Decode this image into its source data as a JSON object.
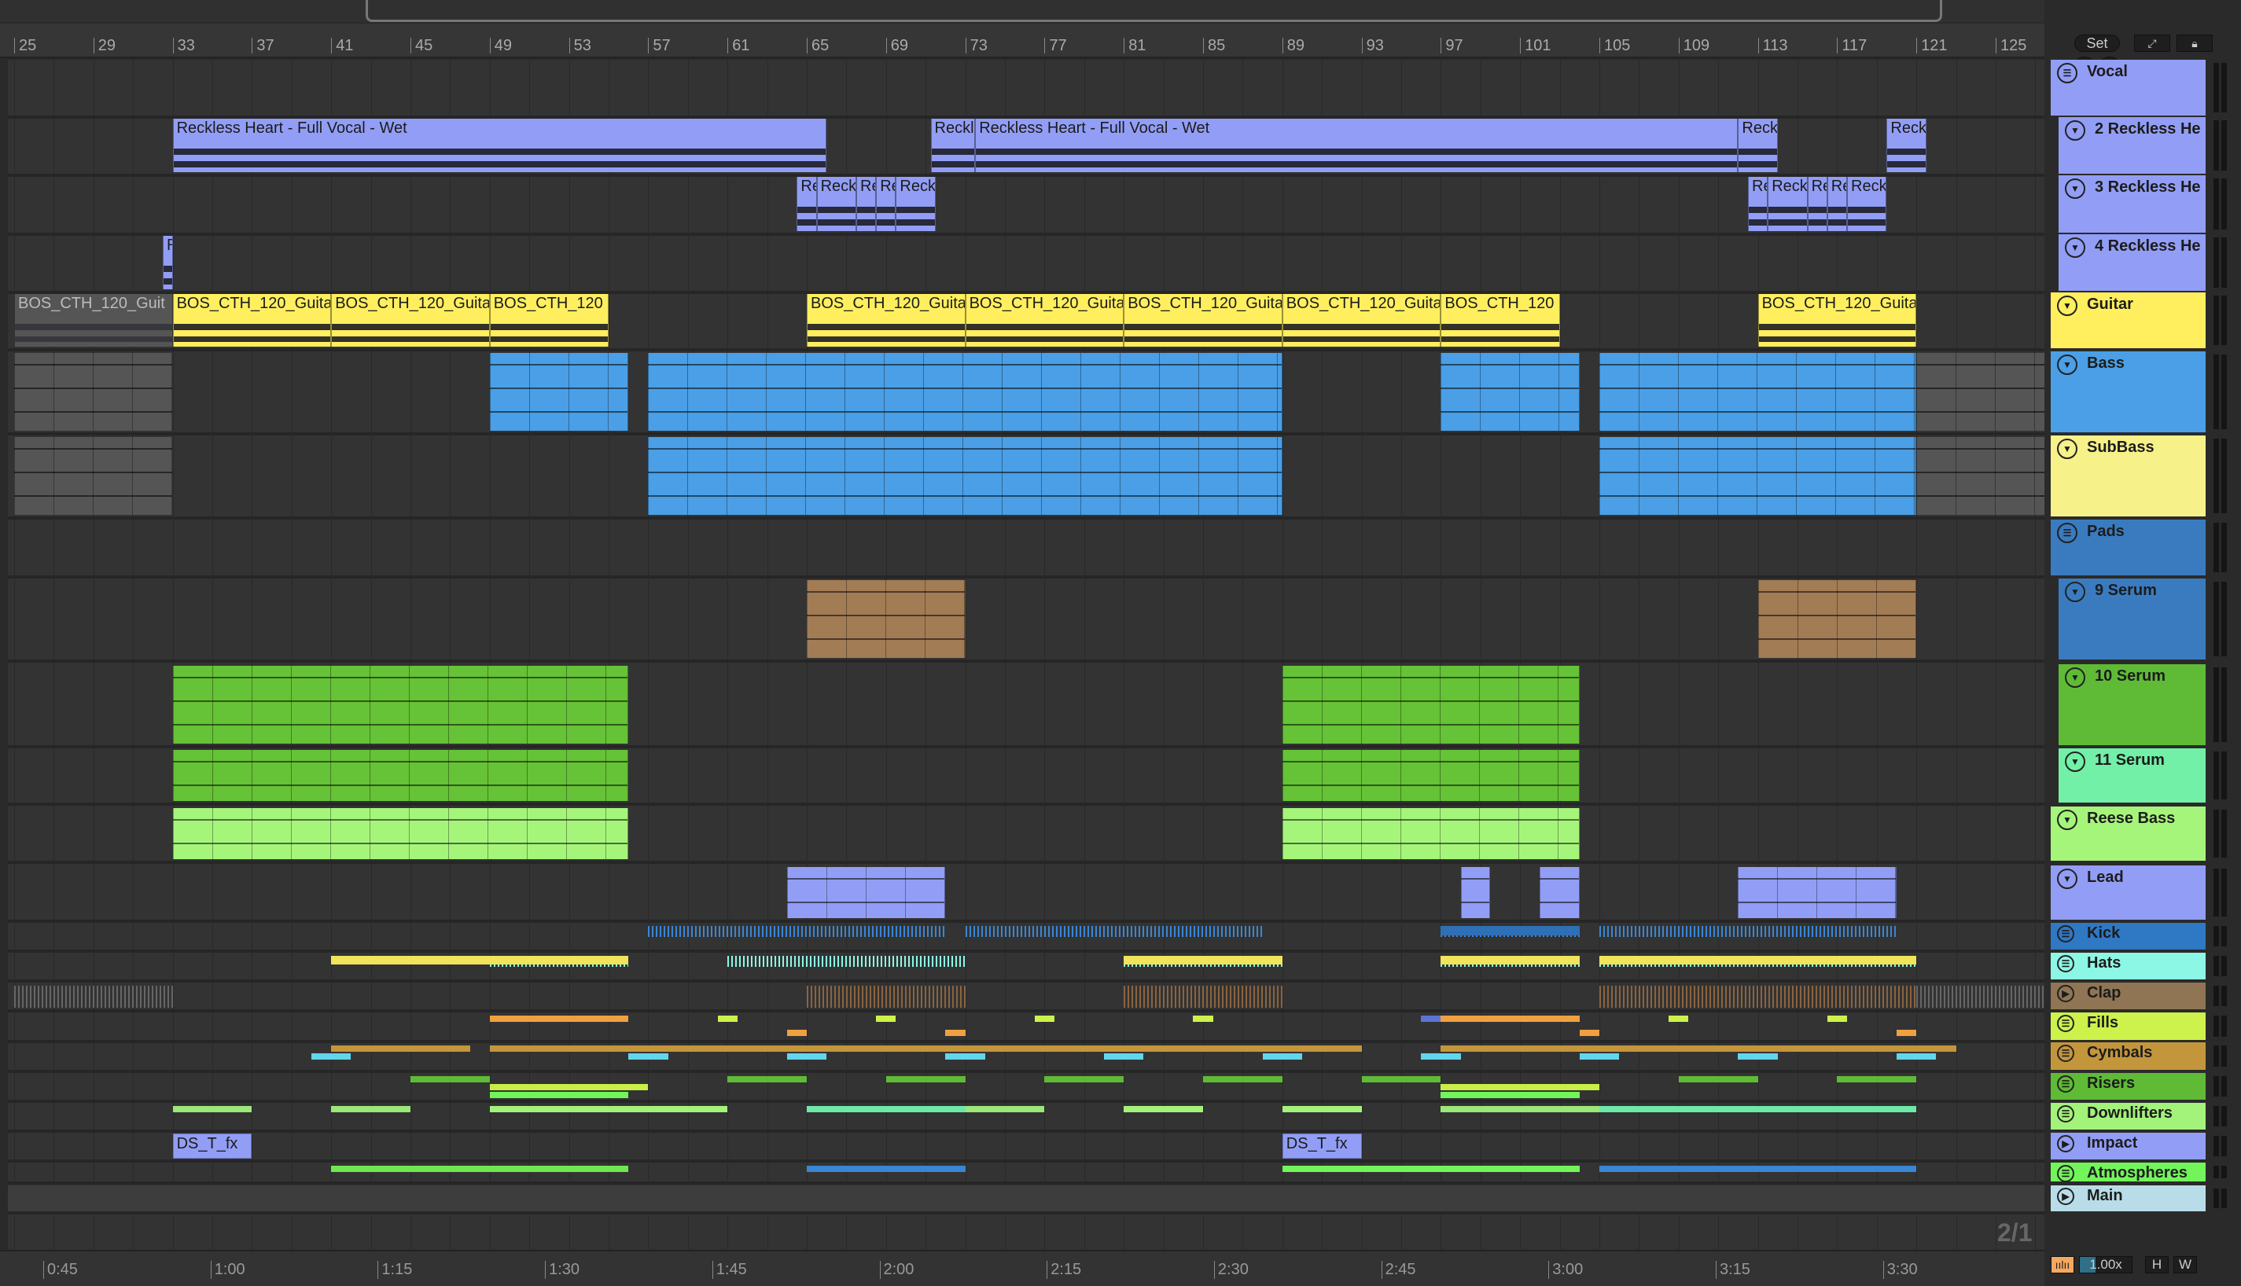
{
  "ruler": {
    "bars": [
      "25",
      "29",
      "33",
      "37",
      "41",
      "45",
      "49",
      "53",
      "57",
      "61",
      "65",
      "69",
      "73",
      "77",
      "81",
      "85",
      "89",
      "93",
      "97",
      "101",
      "105",
      "109",
      "113",
      "117",
      "121",
      "125"
    ]
  },
  "time_ruler": [
    "0:45",
    "1:00",
    "1:15",
    "1:30",
    "1:45",
    "2:00",
    "2:15",
    "2:30",
    "2:45",
    "3:00",
    "3:15",
    "3:30"
  ],
  "controls": {
    "set": "Set",
    "back_icon": "arrow-left-icon",
    "forward_icon": "arrow-right-icon",
    "zoom": "1.00x",
    "h": "H",
    "w": "W",
    "signature": "2/1"
  },
  "tracks": [
    {
      "name": "Vocal",
      "color": "#929ef5",
      "icon": "group",
      "clips": []
    },
    {
      "name": "2 Reckless He",
      "color": "#929ef5",
      "icon": "fold",
      "child": true,
      "clips": [
        {
          "s": 33,
          "e": 66,
          "label": "Reckless Heart - Full Vocal - Wet",
          "kind": "wave"
        },
        {
          "s": 71.25,
          "e": 73.5,
          "label": "Reckl",
          "kind": "wave"
        },
        {
          "s": 73.5,
          "e": 112,
          "label": "Reckless Heart - Full Vocal - Wet",
          "kind": "wave"
        },
        {
          "s": 112,
          "e": 114,
          "label": "Reck",
          "kind": "wave"
        },
        {
          "s": 119.5,
          "e": 121.5,
          "label": "Reckl",
          "kind": "wave"
        }
      ]
    },
    {
      "name": "3 Reckless He",
      "color": "#929ef5",
      "icon": "fold",
      "child": true,
      "clips": [
        {
          "s": 64.5,
          "e": 65.5,
          "label": "Re",
          "kind": "wave"
        },
        {
          "s": 65.5,
          "e": 67.5,
          "label": "Reck",
          "kind": "wave"
        },
        {
          "s": 67.5,
          "e": 68.5,
          "label": "Re",
          "kind": "wave"
        },
        {
          "s": 68.5,
          "e": 69.5,
          "label": "Re",
          "kind": "wave"
        },
        {
          "s": 69.5,
          "e": 71.5,
          "label": "Reck",
          "kind": "wave"
        },
        {
          "s": 112.5,
          "e": 113.5,
          "label": "Re",
          "kind": "wave"
        },
        {
          "s": 113.5,
          "e": 115.5,
          "label": "Reck",
          "kind": "wave"
        },
        {
          "s": 115.5,
          "e": 116.5,
          "label": "Re",
          "kind": "wave"
        },
        {
          "s": 116.5,
          "e": 117.5,
          "label": "Re",
          "kind": "wave"
        },
        {
          "s": 117.5,
          "e": 119.5,
          "label": "Reck",
          "kind": "wave"
        }
      ]
    },
    {
      "name": "4 Reckless He",
      "color": "#929ef5",
      "icon": "fold",
      "child": true,
      "clips": [
        {
          "s": 32.5,
          "e": 33,
          "label": "R",
          "kind": "wave"
        }
      ]
    },
    {
      "name": "Guitar",
      "color": "#ffef5e",
      "icon": "fold",
      "clips": [
        {
          "s": 25,
          "e": 33,
          "label": "BOS_CTH_120_Guit",
          "kind": "wave",
          "off": true
        },
        {
          "s": 33,
          "e": 41,
          "label": "BOS_CTH_120_Guita",
          "kind": "wave"
        },
        {
          "s": 41,
          "e": 49,
          "label": "BOS_CTH_120_Guita",
          "kind": "wave"
        },
        {
          "s": 49,
          "e": 55,
          "label": "BOS_CTH_120",
          "kind": "wave"
        },
        {
          "s": 65,
          "e": 73,
          "label": "BOS_CTH_120_Guita",
          "kind": "wave"
        },
        {
          "s": 73,
          "e": 81,
          "label": "BOS_CTH_120_Guita",
          "kind": "wave"
        },
        {
          "s": 81,
          "e": 89,
          "label": "BOS_CTH_120_Guita",
          "kind": "wave"
        },
        {
          "s": 89,
          "e": 97,
          "label": "BOS_CTH_120_Guita",
          "kind": "wave"
        },
        {
          "s": 97,
          "e": 103,
          "label": "BOS_CTH_120",
          "kind": "wave"
        },
        {
          "s": 113,
          "e": 121,
          "label": "BOS_CTH_120_Guita",
          "kind": "wave"
        }
      ]
    },
    {
      "name": "Bass",
      "color": "#4a9fe6",
      "icon": "fold",
      "clips": [
        {
          "s": 25,
          "e": 33,
          "label": "",
          "kind": "midi",
          "off": true
        },
        {
          "s": 49,
          "e": 56,
          "label": "",
          "kind": "midi"
        },
        {
          "s": 57,
          "e": 89,
          "label": "",
          "kind": "midi"
        },
        {
          "s": 97,
          "e": 104,
          "label": "",
          "kind": "midi"
        },
        {
          "s": 105,
          "e": 121,
          "label": "",
          "kind": "midi"
        },
        {
          "s": 121,
          "e": 127.5,
          "label": "",
          "kind": "midi",
          "off": true
        }
      ]
    },
    {
      "name": "SubBass",
      "color": "#f7f18a",
      "clipcolor": "#4a9fe6",
      "icon": "fold",
      "clips": [
        {
          "s": 25,
          "e": 33,
          "label": "",
          "kind": "midi",
          "off": true
        },
        {
          "s": 57,
          "e": 89,
          "label": "",
          "kind": "midi"
        },
        {
          "s": 105,
          "e": 121,
          "label": "",
          "kind": "midi"
        },
        {
          "s": 121,
          "e": 127.5,
          "label": "",
          "kind": "midi",
          "off": true
        }
      ]
    },
    {
      "name": "Pads",
      "color": "#3a7bc0",
      "icon": "group",
      "clips": []
    },
    {
      "name": "9 Serum",
      "color": "#3a7bc0",
      "clipcolor": "#a27c55",
      "icon": "fold",
      "child": true,
      "clips": [
        {
          "s": 65,
          "e": 73,
          "label": "",
          "kind": "midi"
        },
        {
          "s": 113,
          "e": 121,
          "label": "",
          "kind": "midi"
        }
      ]
    },
    {
      "name": "10 Serum",
      "color": "#5fbb36",
      "clipcolor": "#66c236",
      "icon": "fold",
      "child": true,
      "clips": [
        {
          "s": 33,
          "e": 56,
          "label": "",
          "kind": "midi"
        },
        {
          "s": 89,
          "e": 104,
          "label": "",
          "kind": "midi"
        }
      ]
    },
    {
      "name": "11 Serum",
      "color": "#72f0a8",
      "clipcolor": "#66c236",
      "icon": "fold",
      "child": true,
      "clips": [
        {
          "s": 33,
          "e": 56,
          "label": "",
          "kind": "midi"
        },
        {
          "s": 89,
          "e": 104,
          "label": "",
          "kind": "midi"
        }
      ]
    },
    {
      "name": "Reese Bass",
      "color": "#a6f57b",
      "icon": "fold",
      "clips": [
        {
          "s": 33,
          "e": 56,
          "label": "",
          "kind": "midi"
        },
        {
          "s": 89,
          "e": 104,
          "label": "",
          "kind": "midi"
        }
      ]
    },
    {
      "name": "Lead",
      "color": "#929ef5",
      "icon": "fold",
      "clips": [
        {
          "s": 64,
          "e": 72,
          "label": "",
          "kind": "midi"
        },
        {
          "s": 98,
          "e": 99.5,
          "label": "",
          "kind": "midi"
        },
        {
          "s": 102,
          "e": 104,
          "label": "",
          "kind": "midi"
        },
        {
          "s": 112,
          "e": 120,
          "label": "",
          "kind": "midi"
        }
      ]
    },
    {
      "name": "Kick",
      "color": "#2f78c4",
      "icon": "group",
      "clips": [
        {
          "s": 57,
          "e": 72,
          "kind": "ticks",
          "c": "#3a86d4"
        },
        {
          "s": 73,
          "e": 88,
          "kind": "ticks",
          "c": "#3a86d4"
        },
        {
          "s": 97,
          "e": 104,
          "kind": "ticks",
          "c": "#3a86d4"
        },
        {
          "s": 97,
          "e": 104,
          "kind": "bar",
          "c": "#2f6fb5",
          "lane": 1
        },
        {
          "s": 105,
          "e": 120,
          "kind": "ticks",
          "c": "#3a86d4"
        }
      ]
    },
    {
      "name": "Hats",
      "color": "#8cf7e5",
      "icon": "group",
      "clips": [
        {
          "s": 49,
          "e": 56,
          "kind": "ticks",
          "c": "#8cf7e5"
        },
        {
          "s": 61,
          "e": 73,
          "kind": "ticks",
          "c": "#8cf7e5"
        },
        {
          "s": 81,
          "e": 89,
          "kind": "ticks",
          "c": "#8cf7e5"
        },
        {
          "s": 97,
          "e": 104,
          "kind": "ticks",
          "c": "#8cf7e5"
        },
        {
          "s": 105,
          "e": 121,
          "kind": "ticks",
          "c": "#8cf7e5"
        },
        {
          "s": 41,
          "e": 56,
          "kind": "bar",
          "c": "#f0e45a",
          "lane": 1
        },
        {
          "s": 81,
          "e": 89,
          "kind": "bar",
          "c": "#f0e45a",
          "lane": 1
        },
        {
          "s": 97,
          "e": 104,
          "kind": "bar",
          "c": "#f0e45a",
          "lane": 1
        },
        {
          "s": 105,
          "e": 121,
          "kind": "bar",
          "c": "#f0e45a",
          "lane": 1
        }
      ]
    },
    {
      "name": "Clap",
      "color": "#8f7553",
      "icon": "play",
      "clips": [
        {
          "s": 25,
          "e": 33,
          "kind": "ticks",
          "c": "#666"
        },
        {
          "s": 65,
          "e": 73,
          "kind": "ticks",
          "c": "#8a6440"
        },
        {
          "s": 81,
          "e": 89,
          "kind": "ticks",
          "c": "#8a6440"
        },
        {
          "s": 105,
          "e": 121,
          "kind": "ticks",
          "c": "#8a6440"
        },
        {
          "s": 121,
          "e": 127.5,
          "kind": "ticks",
          "c": "#666"
        }
      ]
    },
    {
      "name": "Fills",
      "color": "#cdf24c",
      "icon": "group",
      "clips": [
        {
          "s": 60.5,
          "e": 61.5,
          "kind": "bar",
          "c": "#cdf24c",
          "lane": 0
        },
        {
          "s": 68.5,
          "e": 69.5,
          "kind": "bar",
          "c": "#cdf24c",
          "lane": 0
        },
        {
          "s": 76.5,
          "e": 77.5,
          "kind": "bar",
          "c": "#cdf24c",
          "lane": 0
        },
        {
          "s": 84.5,
          "e": 85.5,
          "kind": "bar",
          "c": "#cdf24c",
          "lane": 0
        },
        {
          "s": 108.5,
          "e": 109.5,
          "kind": "bar",
          "c": "#cdf24c",
          "lane": 0
        },
        {
          "s": 116.5,
          "e": 117.5,
          "kind": "bar",
          "c": "#cdf24c",
          "lane": 0
        },
        {
          "s": 64,
          "e": 65,
          "kind": "bar",
          "c": "#f0a040",
          "lane": 1
        },
        {
          "s": 72,
          "e": 73,
          "kind": "bar",
          "c": "#f0a040",
          "lane": 1
        },
        {
          "s": 104,
          "e": 105,
          "kind": "bar",
          "c": "#f0a040",
          "lane": 1
        },
        {
          "s": 120,
          "e": 121,
          "kind": "bar",
          "c": "#f0a040",
          "lane": 1
        },
        {
          "s": 96,
          "e": 98,
          "kind": "bar",
          "c": "#5b74d4",
          "lane": 2
        },
        {
          "s": 49,
          "e": 56,
          "kind": "bar",
          "c": "#f0a040",
          "lane": 3
        },
        {
          "s": 97,
          "e": 104,
          "kind": "bar",
          "c": "#f0a040",
          "lane": 3
        }
      ]
    },
    {
      "name": "Cymbals",
      "color": "#c4963c",
      "icon": "group",
      "clips": [
        {
          "s": 41,
          "e": 48,
          "kind": "bar",
          "c": "#c4963c",
          "lane": 0
        },
        {
          "s": 49,
          "e": 93,
          "kind": "bar",
          "c": "#c4963c",
          "lane": 0
        },
        {
          "s": 97,
          "e": 123,
          "kind": "bar",
          "c": "#c4963c",
          "lane": 0
        },
        {
          "s": 40,
          "e": 42,
          "kind": "bar",
          "c": "#62d6ec",
          "lane": 1
        },
        {
          "s": 56,
          "e": 58,
          "kind": "bar",
          "c": "#62d6ec",
          "lane": 1
        },
        {
          "s": 64,
          "e": 66,
          "kind": "bar",
          "c": "#62d6ec",
          "lane": 1
        },
        {
          "s": 72,
          "e": 74,
          "kind": "bar",
          "c": "#62d6ec",
          "lane": 1
        },
        {
          "s": 80,
          "e": 82,
          "kind": "bar",
          "c": "#62d6ec",
          "lane": 1
        },
        {
          "s": 88,
          "e": 90,
          "kind": "bar",
          "c": "#62d6ec",
          "lane": 1
        },
        {
          "s": 96,
          "e": 98,
          "kind": "bar",
          "c": "#62d6ec",
          "lane": 1
        },
        {
          "s": 104,
          "e": 106,
          "kind": "bar",
          "c": "#62d6ec",
          "lane": 1
        },
        {
          "s": 112,
          "e": 114,
          "kind": "bar",
          "c": "#62d6ec",
          "lane": 1
        },
        {
          "s": 120,
          "e": 122,
          "kind": "bar",
          "c": "#62d6ec",
          "lane": 1
        }
      ]
    },
    {
      "name": "Risers",
      "color": "#5fbb36",
      "icon": "group",
      "clips": [
        {
          "s": 45,
          "e": 49,
          "kind": "bar",
          "c": "#5fbb36",
          "lane": 0
        },
        {
          "s": 61,
          "e": 65,
          "kind": "bar",
          "c": "#5fbb36",
          "lane": 0
        },
        {
          "s": 69,
          "e": 73,
          "kind": "bar",
          "c": "#5fbb36",
          "lane": 0
        },
        {
          "s": 77,
          "e": 81,
          "kind": "bar",
          "c": "#5fbb36",
          "lane": 0
        },
        {
          "s": 85,
          "e": 89,
          "kind": "bar",
          "c": "#5fbb36",
          "lane": 0
        },
        {
          "s": 93,
          "e": 97,
          "kind": "bar",
          "c": "#5fbb36",
          "lane": 0
        },
        {
          "s": 109,
          "e": 113,
          "kind": "bar",
          "c": "#5fbb36",
          "lane": 0
        },
        {
          "s": 117,
          "e": 121,
          "kind": "bar",
          "c": "#5fbb36",
          "lane": 0
        },
        {
          "s": 49,
          "e": 57,
          "kind": "bar",
          "c": "#c8ee48",
          "lane": 1
        },
        {
          "s": 97,
          "e": 105,
          "kind": "bar",
          "c": "#c8ee48",
          "lane": 1
        },
        {
          "s": 49,
          "e": 56,
          "kind": "bar",
          "c": "#72f55a",
          "lane": 2
        },
        {
          "s": 97,
          "e": 104,
          "kind": "bar",
          "c": "#72f55a",
          "lane": 2
        }
      ]
    },
    {
      "name": "Downlifters",
      "color": "#a3f27a",
      "icon": "group",
      "clips": [
        {
          "s": 33,
          "e": 37,
          "kind": "bar",
          "c": "#9be77a",
          "lane": 0
        },
        {
          "s": 41,
          "e": 45,
          "kind": "bar",
          "c": "#9be77a",
          "lane": 0
        },
        {
          "s": 49,
          "e": 61,
          "kind": "bar",
          "c": "#a3f27a",
          "lane": 0
        },
        {
          "s": 65,
          "e": 69,
          "kind": "bar",
          "c": "#9be77a",
          "lane": 0
        },
        {
          "s": 73,
          "e": 77,
          "kind": "bar",
          "c": "#9be77a",
          "lane": 0
        },
        {
          "s": 81,
          "e": 85,
          "kind": "bar",
          "c": "#a3f27a",
          "lane": 0
        },
        {
          "s": 89,
          "e": 93,
          "kind": "bar",
          "c": "#a3f27a",
          "lane": 0
        },
        {
          "s": 97,
          "e": 109,
          "kind": "bar",
          "c": "#9be77a",
          "lane": 0
        },
        {
          "s": 113,
          "e": 117,
          "kind": "bar",
          "c": "#a3f27a",
          "lane": 0
        },
        {
          "s": 105,
          "e": 109,
          "kind": "bar",
          "c": "#62d6ec",
          "lane": 1
        },
        {
          "s": 65,
          "e": 73,
          "kind": "bar",
          "c": "#6ee8a8",
          "lane": 2
        },
        {
          "s": 105,
          "e": 121,
          "kind": "bar",
          "c": "#6ee8a8",
          "lane": 2
        }
      ]
    },
    {
      "name": "Impact",
      "color": "#929ef5",
      "icon": "play",
      "clips": [
        {
          "s": 33,
          "e": 37,
          "label": "DS_T_fx",
          "kind": "label"
        },
        {
          "s": 89,
          "e": 93,
          "label": "DS_T_fx",
          "kind": "label"
        }
      ]
    },
    {
      "name": "Atmospheres",
      "color": "#72f55a",
      "icon": "group",
      "clips": [
        {
          "s": 41,
          "e": 56,
          "kind": "bar",
          "c": "#6ee84e",
          "lane": 0
        },
        {
          "s": 65,
          "e": 73,
          "kind": "bar",
          "c": "#6ee84e",
          "lane": 0
        },
        {
          "s": 89,
          "e": 104,
          "kind": "bar",
          "c": "#72f55a",
          "lane": 0
        },
        {
          "s": 105,
          "e": 121,
          "kind": "bar",
          "c": "#6ee84e",
          "lane": 0
        },
        {
          "s": 65,
          "e": 73,
          "kind": "bar",
          "c": "#3a86d4",
          "lane": 1
        },
        {
          "s": 105,
          "e": 121,
          "kind": "bar",
          "c": "#3a86d4",
          "lane": 1
        }
      ]
    },
    {
      "name": "Main",
      "color": "#b8dde8",
      "icon": "play",
      "clips": []
    }
  ]
}
